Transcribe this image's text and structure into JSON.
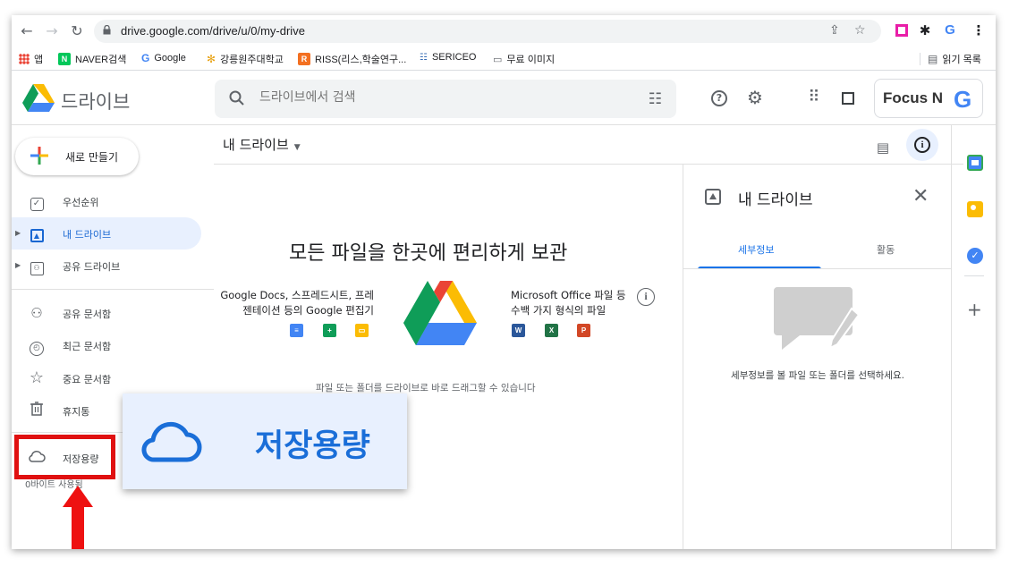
{
  "browser": {
    "url": "drive.google.com/drive/u/0/my-drive",
    "bookmarks": [
      {
        "label": "앱",
        "icon": "apps-grid-icon"
      },
      {
        "label": "NAVER검색",
        "icon": "naver-icon"
      },
      {
        "label": "Google",
        "icon": "google-icon"
      },
      {
        "label": "강릉원주대학교",
        "icon": "university-icon"
      },
      {
        "label": "RISS(리스,학술연구...",
        "icon": "riss-icon"
      },
      {
        "label": "SERICEO",
        "icon": "sericeo-icon"
      },
      {
        "label": "무료 이미지",
        "icon": "folder-icon"
      }
    ],
    "reading_list": "읽기 목록"
  },
  "header": {
    "brand": "드라이브",
    "search_placeholder": "드라이브에서 검색",
    "account_org": "Focus N",
    "account_google": "G"
  },
  "sidebar": {
    "new_label": "새로 만들기",
    "items": [
      {
        "label": "우선순위",
        "icon": "priority-check-icon"
      },
      {
        "label": "내 드라이브",
        "icon": "my-drive-icon"
      },
      {
        "label": "공유 드라이브",
        "icon": "shared-drive-icon"
      },
      {
        "label": "공유 문서함",
        "icon": "people-icon"
      },
      {
        "label": "최근 문서함",
        "icon": "clock-icon"
      },
      {
        "label": "중요 문서함",
        "icon": "star-icon"
      },
      {
        "label": "휴지통",
        "icon": "trash-icon"
      },
      {
        "label": "저장용량",
        "icon": "cloud-icon"
      }
    ],
    "storage_sub": "0바이트 사용됨"
  },
  "callout": {
    "label": "저장용량"
  },
  "main": {
    "title": "내 드라이브",
    "hero": "모든 파일을 한곳에 편리하게 보관",
    "left_desc": "Google Docs, 스프레드시트, 프레젠테이션 등의 Google 편집기",
    "right_desc": "Microsoft Office 파일 등 수백 가지 형식의 파일",
    "drag_hint": "파일 또는 폴더를 드라이브로 바로 드래그할 수 있습니다",
    "ms_apps": [
      "W",
      "X",
      "P"
    ]
  },
  "details": {
    "title": "내 드라이브",
    "tabs": [
      "세부정보",
      "활동"
    ],
    "empty_message": "세부정보를 볼 파일 또는 폴더를 선택하세요."
  },
  "colors": {
    "accent": "#1a73e8",
    "active_bg": "#e8f0fe",
    "highlight_red": "#e01010"
  }
}
